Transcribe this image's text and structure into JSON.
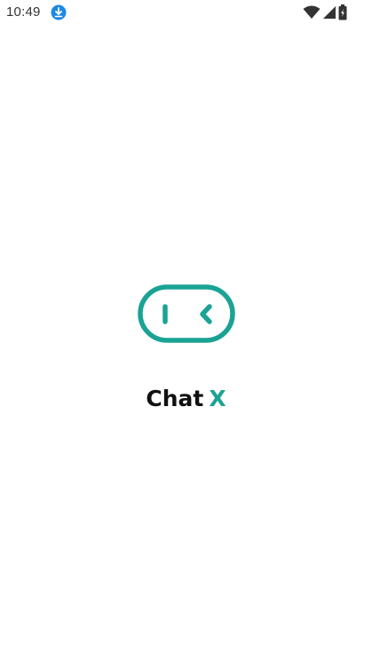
{
  "status_bar": {
    "time": "10:49",
    "icons": [
      "download-icon",
      "wifi-icon",
      "cell-signal-icon",
      "battery-icon"
    ]
  },
  "splash": {
    "logo_icon": "chat-bubble-face-icon",
    "brand_text": "Chat",
    "brand_accent_text": "X"
  },
  "colors": {
    "accent": "#1aa395",
    "download_badge": "#1e88e5",
    "text_dark": "#111111",
    "status_icons": "#333333",
    "background": "#ffffff"
  }
}
